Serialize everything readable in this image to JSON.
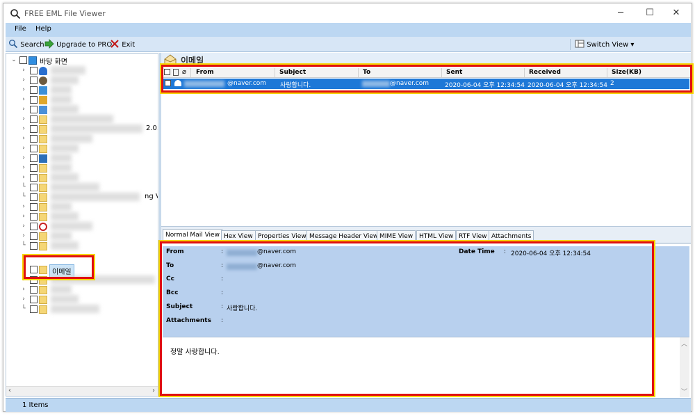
{
  "window": {
    "title": "FREE EML File Viewer",
    "minimize": "─",
    "maximize": "☐",
    "close": "✕"
  },
  "menu": {
    "file": "File",
    "help": "Help"
  },
  "toolbar": {
    "search": "Search",
    "upgrade": "Upgrade to PRO",
    "exit": "Exit",
    "switch_view": "Switch View",
    "switch_arrow": "▾"
  },
  "tree": {
    "root": "바탕 화면",
    "partial_1": "2.0.",
    "partial_2": "ng V",
    "email_folder": "이메일"
  },
  "folder_header": {
    "title": "이메일"
  },
  "list": {
    "columns": [
      "From",
      "Subject",
      "To",
      "Sent",
      "Received",
      "Size(KB)"
    ],
    "row": {
      "from": "@naver.com",
      "subject": "사랑합니다.",
      "to": "@naver.com",
      "sent": "2020-06-04 오후 12:34:54",
      "received": "2020-06-04 오후 12:34:54",
      "size": "2"
    }
  },
  "tabs": [
    "Normal Mail View",
    "Hex View",
    "Properties View",
    "Message Header View",
    "MIME View",
    "HTML View",
    "RTF View",
    "Attachments"
  ],
  "mail": {
    "from_label": "From",
    "from_value": "@naver.com",
    "to_label": "To",
    "to_value": "@naver.com",
    "cc_label": "Cc",
    "bcc_label": "Bcc",
    "subject_label": "Subject",
    "subject_value": "사랑합니다.",
    "attachments_label": "Attachments",
    "date_label": "Date Time",
    "date_value": "2020-06-04 오후 12:34:54",
    "colon": ":",
    "body": "정말 사랑합니다."
  },
  "status": {
    "items": "1 Items"
  },
  "colors": {
    "accent": "#1e78d7",
    "highlight": "#e01010",
    "highlight_outer": "#f6d400",
    "header_bg": "#b8d0ee",
    "bar_bg": "#bcd7f2"
  }
}
